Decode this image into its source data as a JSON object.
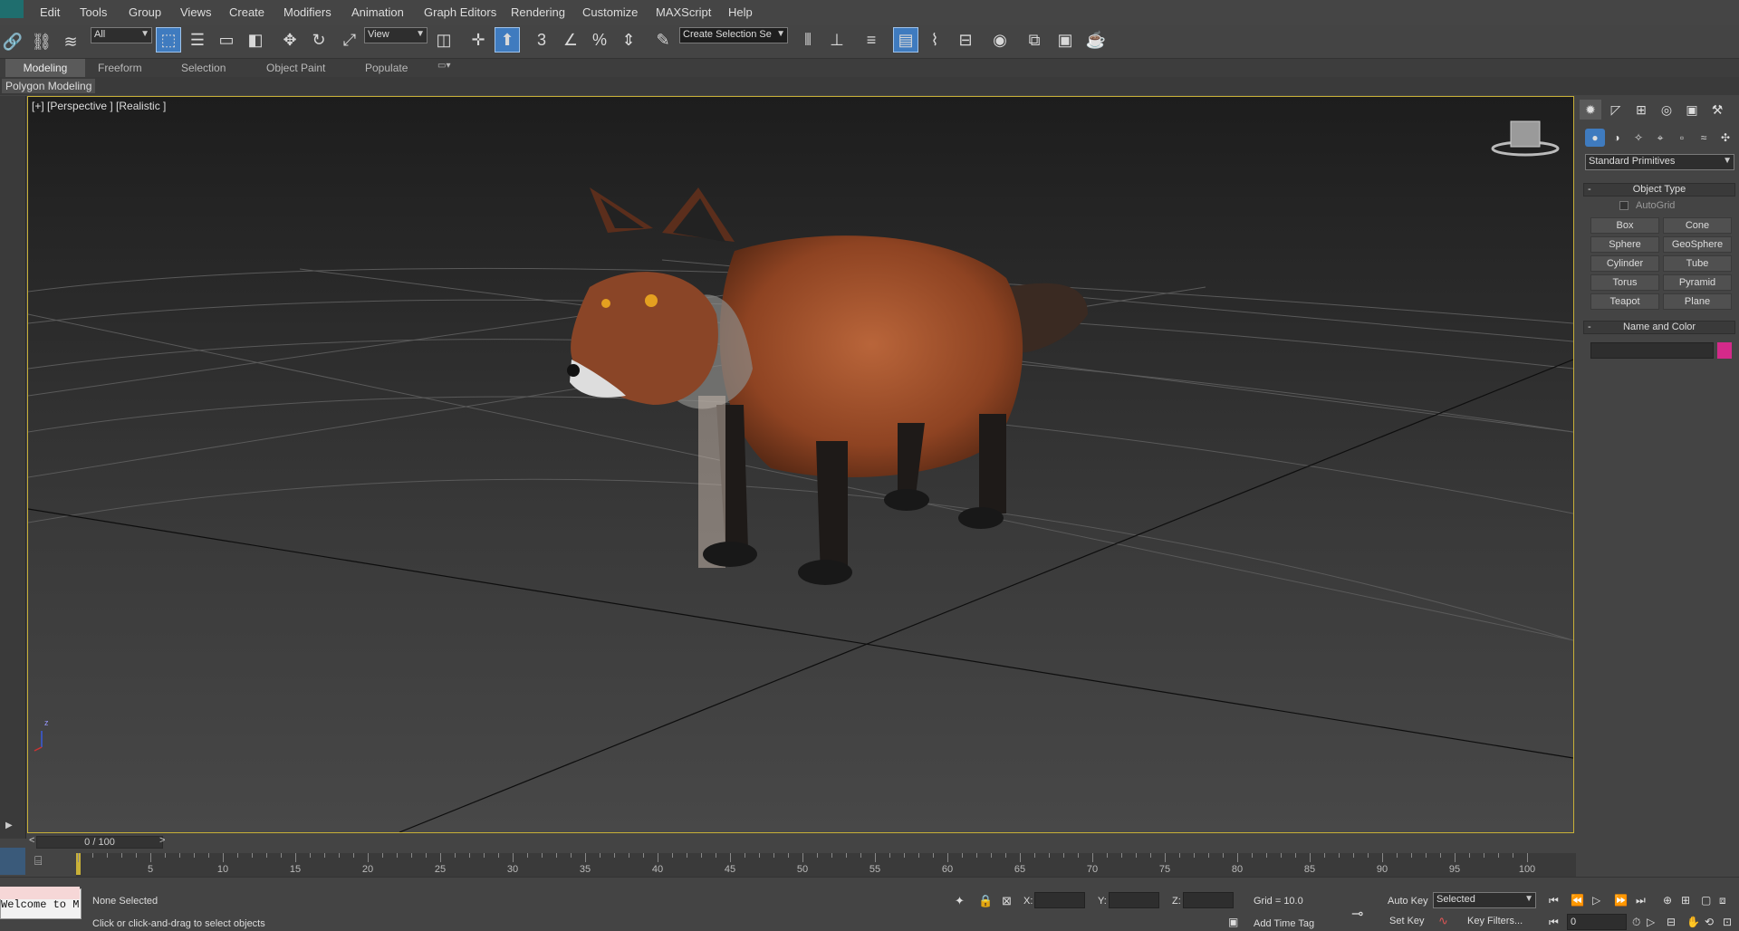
{
  "menu": {
    "items": [
      "Edit",
      "Tools",
      "Group",
      "Views",
      "Create",
      "Modifiers",
      "Animation",
      "Graph Editors",
      "Rendering",
      "Customize",
      "MAXScript",
      "Help"
    ]
  },
  "toolbar": {
    "selection_filter": "All",
    "reference_coord": "View",
    "snap_label": "3",
    "angle_snap_label": "%",
    "named_selection": "Create Selection Se"
  },
  "ribbon": {
    "tabs": [
      "Modeling",
      "Freeform",
      "Selection",
      "Object Paint",
      "Populate"
    ],
    "panel_label": "Polygon Modeling"
  },
  "viewport": {
    "label": "[+] [Perspective ] [Realistic ]",
    "axis_label": "z"
  },
  "command_panel": {
    "category_dropdown": "Standard Primitives",
    "object_type_title": "Object Type",
    "autogrid_label": "AutoGrid",
    "buttons": [
      "Box",
      "Cone",
      "Sphere",
      "GeoSphere",
      "Cylinder",
      "Tube",
      "Torus",
      "Pyramid",
      "Teapot",
      "Plane"
    ],
    "name_color_title": "Name and Color",
    "object_color": "#d42a8a"
  },
  "timeline": {
    "frame_display": "0 / 100",
    "ticks": [
      "5",
      "10",
      "15",
      "20",
      "25",
      "30",
      "35",
      "40",
      "45",
      "50",
      "55",
      "60",
      "65",
      "70",
      "75",
      "80",
      "85",
      "90",
      "95",
      "100"
    ]
  },
  "status": {
    "maxscript_listener": "Welcome to M",
    "selection_status": "None Selected",
    "prompt": "Click or click-and-drag to select objects",
    "x_label": "X:",
    "y_label": "Y:",
    "z_label": "Z:",
    "grid": "Grid = 10.0",
    "add_time_tag": "Add Time Tag",
    "auto_key": "Auto Key",
    "set_key": "Set Key",
    "key_mode": "Selected",
    "key_filters": "Key Filters...",
    "current_frame": "0"
  },
  "colors": {
    "accent": "#3f7bbf",
    "viewport_border": "#c8b038"
  }
}
